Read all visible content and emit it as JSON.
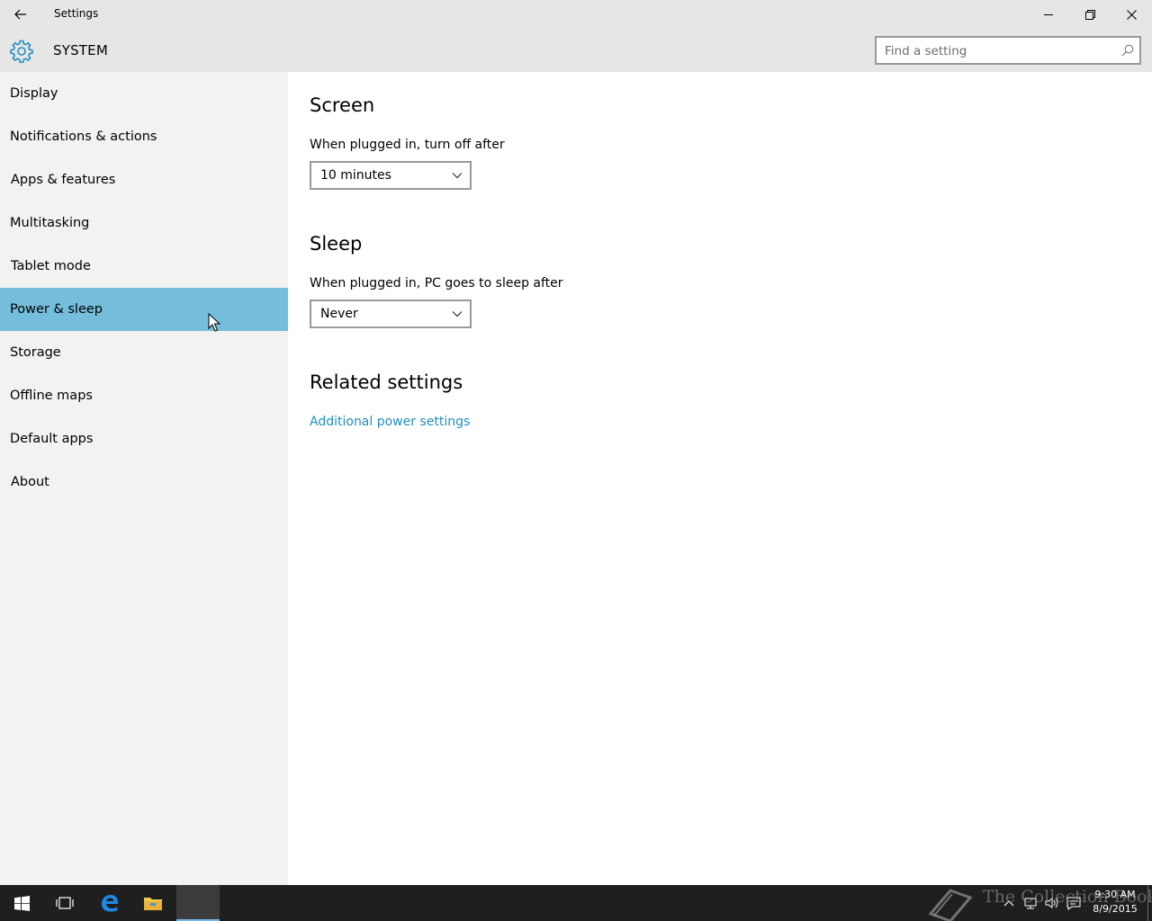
{
  "window": {
    "title": "Settings"
  },
  "header": {
    "title": "SYSTEM",
    "search_placeholder": "Find a setting"
  },
  "sidebar": {
    "selected_index": 5,
    "items": [
      {
        "label": "Display"
      },
      {
        "label": "Notifications & actions"
      },
      {
        "label": "Apps & features"
      },
      {
        "label": "Multitasking"
      },
      {
        "label": "Tablet mode"
      },
      {
        "label": "Power & sleep"
      },
      {
        "label": "Storage"
      },
      {
        "label": "Offline maps"
      },
      {
        "label": "Default apps"
      },
      {
        "label": "About"
      }
    ]
  },
  "main": {
    "screen": {
      "title": "Screen",
      "label": "When plugged in, turn off after",
      "value": "10 minutes"
    },
    "sleep": {
      "title": "Sleep",
      "label": "When plugged in, PC goes to sleep after",
      "value": "Never"
    },
    "related": {
      "title": "Related settings",
      "link": "Additional power settings"
    }
  },
  "taskbar": {
    "time": "9:30 AM",
    "date": "8/9/2015",
    "watermark": "The Collection Book"
  },
  "colors": {
    "accent": "#75bedb",
    "link": "#1f8fc0",
    "titlebar": "#e6e6e6",
    "sidebar": "#f2f2f2",
    "taskbar": "#1f1f1f"
  }
}
